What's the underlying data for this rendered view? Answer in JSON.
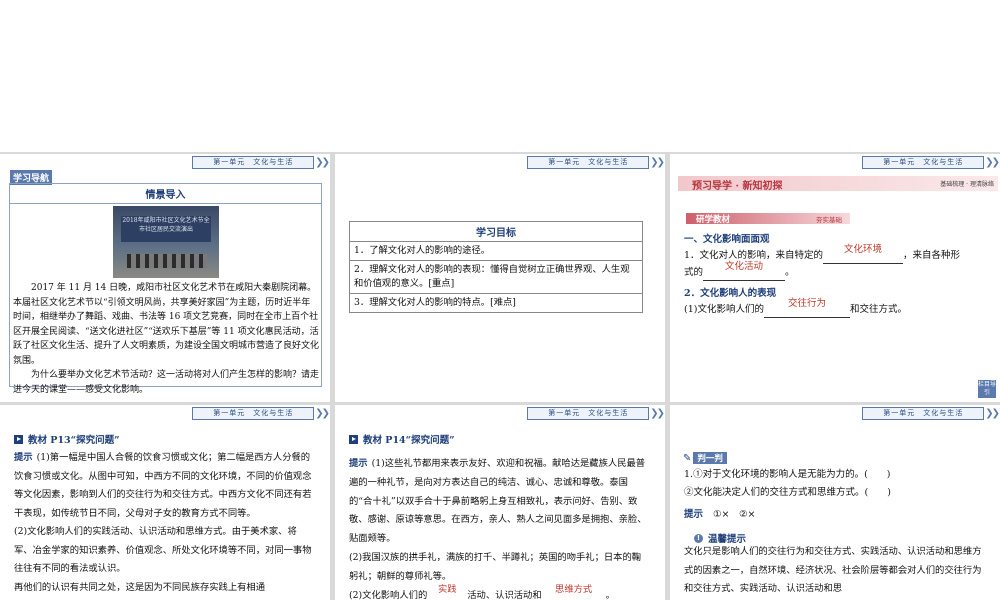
{
  "header_label": "第一单元　文化与生活",
  "panel1": {
    "tag": "学习导航",
    "box_title": "情景导入",
    "photo_caption": "2018年咸阳市社区文化艺术节全市社区居民交流演出",
    "paragraph1": "2017 年 11 月 14 日晚，咸阳市社区文化艺术节在咸阳大秦剧院闭幕。本届社区文化艺术节以“引领文明风尚，共享美好家园”为主题，历时近半年时间，相继举办了舞蹈、戏曲、书法等 16 项文艺竞赛，同时在全市上百个社区开展全民阅读、“送文化进社区”“送欢乐下基层”等 11 项文化惠民活动，活跃了社区文化生活、提升了人文明素质，为建设全国文明城市营造了良好文化氛围。",
    "paragraph2": "为什么要举办文化艺术节活动？这一活动将对人们产生怎样的影响？请走进今天的课堂——感受文化影响。"
  },
  "panel2": {
    "box_title": "学习目标",
    "rows": [
      "1．了解文化对人的影响的途径。",
      "2．理解文化对人的影响的表现：懂得自觉树立正确世界观、人生观和价值观的意义。[重点]",
      "3．理解文化对人的影响的特点。[难点]"
    ]
  },
  "panel3": {
    "bar_left": "预习导学 · 新知初探",
    "bar_right": "基础梳理 · 理清脉络",
    "tag_left": "研学教材",
    "tag_right": "夯实基础",
    "section1": "一、文化影响面面观",
    "line1_a": "1．文化对人的影响，来自特定的",
    "line1_b": "，来自各种形",
    "line2_a": "式的",
    "line2_b": "。",
    "blank1": "文化环境",
    "blank2": "文化活动",
    "section2": "2．文化影响人的表现",
    "line3_a": "(1)文化影响人们的",
    "line3_b": "和交往方式。",
    "blank3": "交往行为",
    "corner_btn": "栏目导引"
  },
  "panel4": {
    "headline": "教材 P13“探究问题”",
    "hint": "提示",
    "p1": "(1)第一幅是中国人合餐的饮食习惯或文化；第二幅是西方人分餐的饮食习惯或文化。从图中可知，中西方不同的文化环境，不同的价值观念等文化因素，影响到人们的交往行为和交往方式。中西方文化不同还有若干表现，如传统节日不同，父母对子女的教育方式不同等。",
    "p2": "(2)文化影响人们的实践活动、认识活动和思维方式。由于美术家、将军、冶金学家的知识素养、价值观念、所处文化环境等不同，对同一事物往往有不同的看法或认识。",
    "p3": "再他们的认识有共同之处，这是因为不同民族存实践上有相通"
  },
  "panel5": {
    "headline": "教材 P14“探究问题”",
    "hint": "提示",
    "p1": "(1)这些礼节都用来表示友好、欢迎和祝福。献哈达是藏族人民最普遍的一种礼节，是向对方表达自己的纯洁、诚心、忠诚和尊敬。泰国的“合十礼”以双手合十于鼻前略躬上身互相致礼，表示问好、告别、致敬、感谢、原谅等意思。在西方，亲人、熟人之间见面多是拥抱、亲脸、贴面颊等。",
    "p2": "(2)我国汉族的拱手礼，满族的打千、半蹲礼；英国的吻手礼；日本的鞠躬礼；朝鲜的尊师礼等。",
    "p3_a": "(2)文化影响人们的",
    "p3_b": "活动、认识活动和",
    "p3_c": "。",
    "blank1": "实践",
    "blank2": "思维方式"
  },
  "panel6": {
    "judge_label": "判一判",
    "q1": "1.①对于文化环境的影响人是无能为力的。(　　)",
    "q2": "②文化能决定人们的交往方式和思维方式。(　　)",
    "hint": "提示",
    "answer": "①×　②×",
    "warm_label": "温馨提示",
    "warm_text": "文化只是影响人们的交往行为和交往方式、实践活动、认识活动和思维方式的因素之一，自然环境、经济状况、社会阶层等都会对人们的交往行为和交往方式、实践活动、认识活动和思"
  }
}
